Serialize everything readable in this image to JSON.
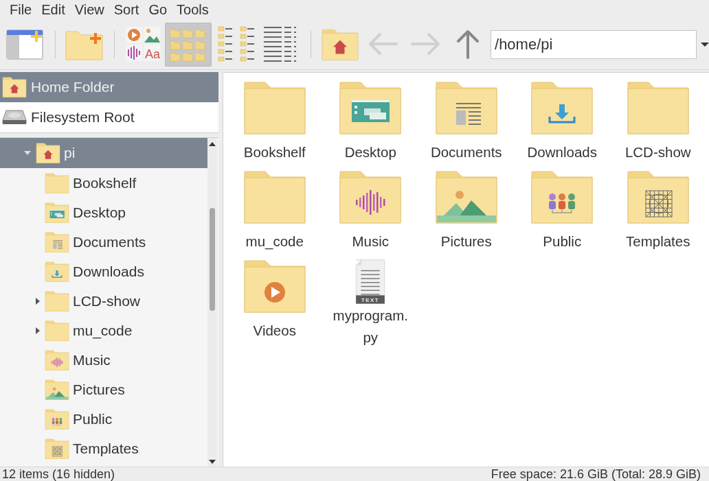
{
  "menu": [
    "File",
    "Edit",
    "View",
    "Sort",
    "Go",
    "Tools"
  ],
  "toolbar": {
    "font_sample": "Aa",
    "views": [
      {
        "kind": "icons",
        "selected": true
      },
      {
        "kind": "compact",
        "selected": false
      },
      {
        "kind": "details",
        "selected": false
      }
    ],
    "back": {
      "disabled": true
    },
    "forward": {
      "disabled": true
    },
    "up": {
      "disabled": false
    },
    "path": "/home/pi"
  },
  "places": [
    {
      "label": "Home Folder",
      "kind": "home",
      "selected": true
    },
    {
      "label": "Filesystem Root",
      "kind": "drive",
      "selected": false
    }
  ],
  "tree": [
    {
      "label": "pi",
      "kind": "home",
      "selected": true,
      "expanded": true,
      "children": [
        {
          "label": "Bookshelf",
          "kind": "folder",
          "selected": false
        },
        {
          "label": "Desktop",
          "kind": "desktop",
          "selected": false
        },
        {
          "label": "Documents",
          "kind": "documents",
          "selected": false
        },
        {
          "label": "Downloads",
          "kind": "downloads",
          "selected": false
        },
        {
          "label": "LCD-show",
          "kind": "folder",
          "selected": false,
          "expanded": false
        },
        {
          "label": "mu_code",
          "kind": "folder",
          "selected": false,
          "expanded": false
        },
        {
          "label": "Music",
          "kind": "music",
          "selected": false
        },
        {
          "label": "Pictures",
          "kind": "pictures",
          "selected": false
        },
        {
          "label": "Public",
          "kind": "public",
          "selected": false
        },
        {
          "label": "Templates",
          "kind": "templates",
          "selected": false
        }
      ]
    }
  ],
  "files": [
    {
      "label": "Bookshelf",
      "kind": "folder"
    },
    {
      "label": "Desktop",
      "kind": "desktop"
    },
    {
      "label": "Documents",
      "kind": "documents"
    },
    {
      "label": "Downloads",
      "kind": "downloads"
    },
    {
      "label": "LCD-show",
      "kind": "folder"
    },
    {
      "label": "mu_code",
      "kind": "folder"
    },
    {
      "label": "Music",
      "kind": "music"
    },
    {
      "label": "Pictures",
      "kind": "pictures"
    },
    {
      "label": "Public",
      "kind": "public"
    },
    {
      "label": "Templates",
      "kind": "templates"
    },
    {
      "label": "Videos",
      "kind": "videos"
    },
    {
      "label": "myprogram.py",
      "kind": "textfile",
      "badge": "TEXT"
    }
  ],
  "status_bar": {
    "left": "12 items (16 hidden)",
    "right": "Free space: 21.6 GiB (Total: 28.9 GiB)"
  }
}
